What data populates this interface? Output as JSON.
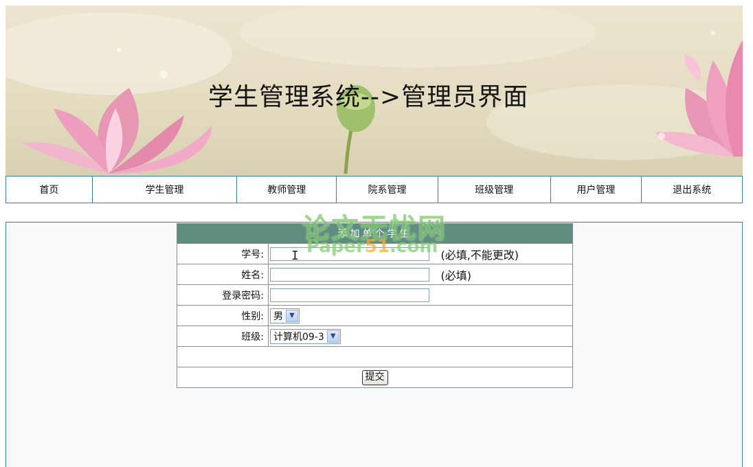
{
  "banner": {
    "title": "学生管理系统-->管理员界面"
  },
  "nav": {
    "items": [
      {
        "label": "首页"
      },
      {
        "label": "学生管理"
      },
      {
        "label": "教师管理"
      },
      {
        "label": "院系管理"
      },
      {
        "label": "班级管理"
      },
      {
        "label": "用户管理"
      },
      {
        "label": "退出系统"
      }
    ]
  },
  "form": {
    "header": "添加单个学生",
    "student_id": {
      "label": "学号:",
      "value": "",
      "note": "(必填,不能更改)"
    },
    "name": {
      "label": "姓名:",
      "value": "",
      "note": "(必填)"
    },
    "password": {
      "label": "登录密码:",
      "value": ""
    },
    "gender": {
      "label": "性别:",
      "selected": "男"
    },
    "class": {
      "label": "班级:",
      "selected": "计算机09-3"
    },
    "submit_label": "提交"
  },
  "watermark": {
    "line1": "论文无忧网",
    "line2_prefix": "Paper",
    "line2_num": "51",
    "line2_suffix": ".com"
  }
}
